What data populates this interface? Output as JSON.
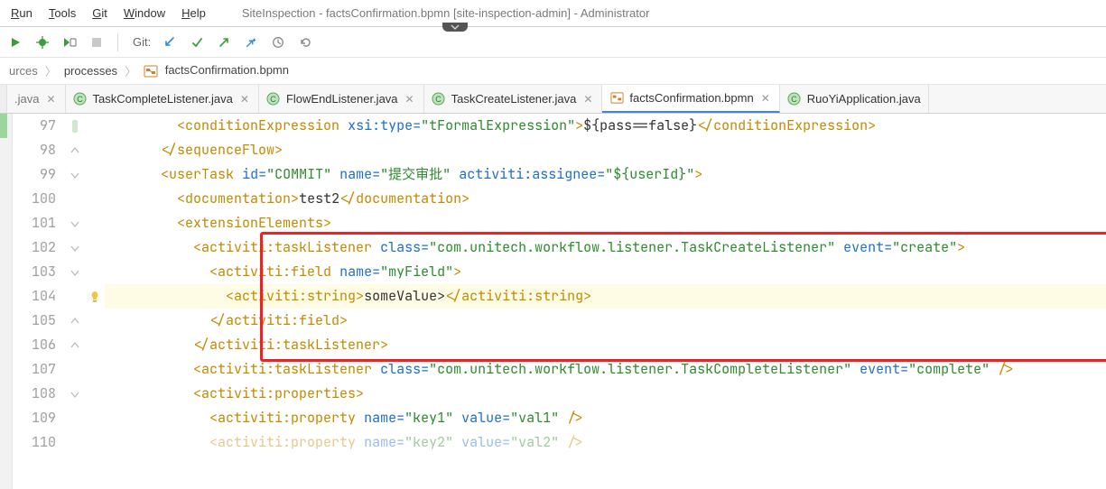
{
  "window": {
    "title": "SiteInspection - factsConfirmation.bpmn [site-inspection-admin] - Administrator"
  },
  "menu": {
    "run": "Run",
    "tools": "Tools",
    "git": "Git",
    "window": "Window",
    "help": "Help"
  },
  "toolbar": {
    "git_label": "Git:"
  },
  "breadcrumbs": {
    "c0": "urces",
    "c1": "processes",
    "c2": "factsConfirmation.bpmn"
  },
  "tabs": {
    "t0_prefix": ".java",
    "t1": "TaskCompleteListener.java",
    "t2": "FlowEndListener.java",
    "t3": "TaskCreateListener.java",
    "t4": "factsConfirmation.bpmn",
    "t5": "RuoYiApplication.java"
  },
  "lines": {
    "l97": "97",
    "l98": "98",
    "l99": "99",
    "l100": "100",
    "l101": "101",
    "l102": "102",
    "l103": "103",
    "l104": "104",
    "l105": "105",
    "l106": "106",
    "l107": "107",
    "l108": "108",
    "l109": "109",
    "l110": "110"
  },
  "code": {
    "r97": {
      "indent": "        ",
      "open": "<",
      "tag": "conditionExpression",
      "sp": " ",
      "a1": "xsi:type",
      "eq": "=",
      "v1": "\"tFormalExpression\"",
      "close1": ">",
      "text": "${pass==false}",
      "open2": "</",
      "tag2": "conditionExpression",
      "close2": ">"
    },
    "r98": {
      "indent": "      ",
      "open": "</",
      "tag": "sequenceFlow",
      "close": ">"
    },
    "r99": {
      "indent": "      ",
      "open": "<",
      "tag": "userTask",
      "sp": " ",
      "a1": "id",
      "v1": "\"COMMIT\"",
      "a2": "name",
      "v2": "\"提交审批\"",
      "a3": "activiti:assignee",
      "v3": "\"${userId}\"",
      "close": ">"
    },
    "r100": {
      "indent": "        ",
      "open": "<",
      "tag": "documentation",
      "close1": ">",
      "text": "test2",
      "open2": "</",
      "tag2": "documentation",
      "close2": ">"
    },
    "r101": {
      "indent": "        ",
      "open": "<",
      "tag": "extensionElements",
      "close": ">"
    },
    "r102": {
      "indent": "          ",
      "open": "<",
      "tag": "activiti:taskListener",
      "sp": " ",
      "a1": "class",
      "v1": "\"com.unitech.workflow.listener.TaskCreateListener\"",
      "a2": "event",
      "v2": "\"create\"",
      "close": ">"
    },
    "r103": {
      "indent": "            ",
      "open": "<",
      "tag": "activiti:field",
      "sp": " ",
      "a1": "name",
      "v1": "\"myField\"",
      "close": ">"
    },
    "r104": {
      "indent": "              ",
      "open": "<",
      "tag": "activiti:string",
      "close1": ">",
      "text": "someValue>",
      "open2": "</",
      "tag2": "activiti:string",
      "close2": ">"
    },
    "r105": {
      "indent": "            ",
      "open": "</",
      "tag": "activiti:field",
      "close": ">"
    },
    "r106": {
      "indent": "          ",
      "open": "</",
      "tag": "activiti:taskListener",
      "close": ">"
    },
    "r107": {
      "indent": "          ",
      "open": "<",
      "tag": "activiti:taskListener",
      "sp": " ",
      "a1": "class",
      "v1": "\"com.unitech.workflow.listener.TaskCompleteListener\"",
      "a2": "event",
      "v2": "\"complete\"",
      "close": " />"
    },
    "r108": {
      "indent": "          ",
      "open": "<",
      "tag": "activiti:properties",
      "close": ">"
    },
    "r109": {
      "indent": "            ",
      "open": "<",
      "tag": "activiti:property",
      "sp": " ",
      "a1": "name",
      "v1": "\"key1\"",
      "a2": "value",
      "v2": "\"val1\"",
      "close": " />"
    },
    "r110": {
      "indent": "            ",
      "open": "<",
      "tag": "activiti:property",
      "sp": " ",
      "a1": "name",
      "v1": "\"key2\"",
      "a2": "value",
      "v2": "\"val2\"",
      "close": " />"
    }
  }
}
